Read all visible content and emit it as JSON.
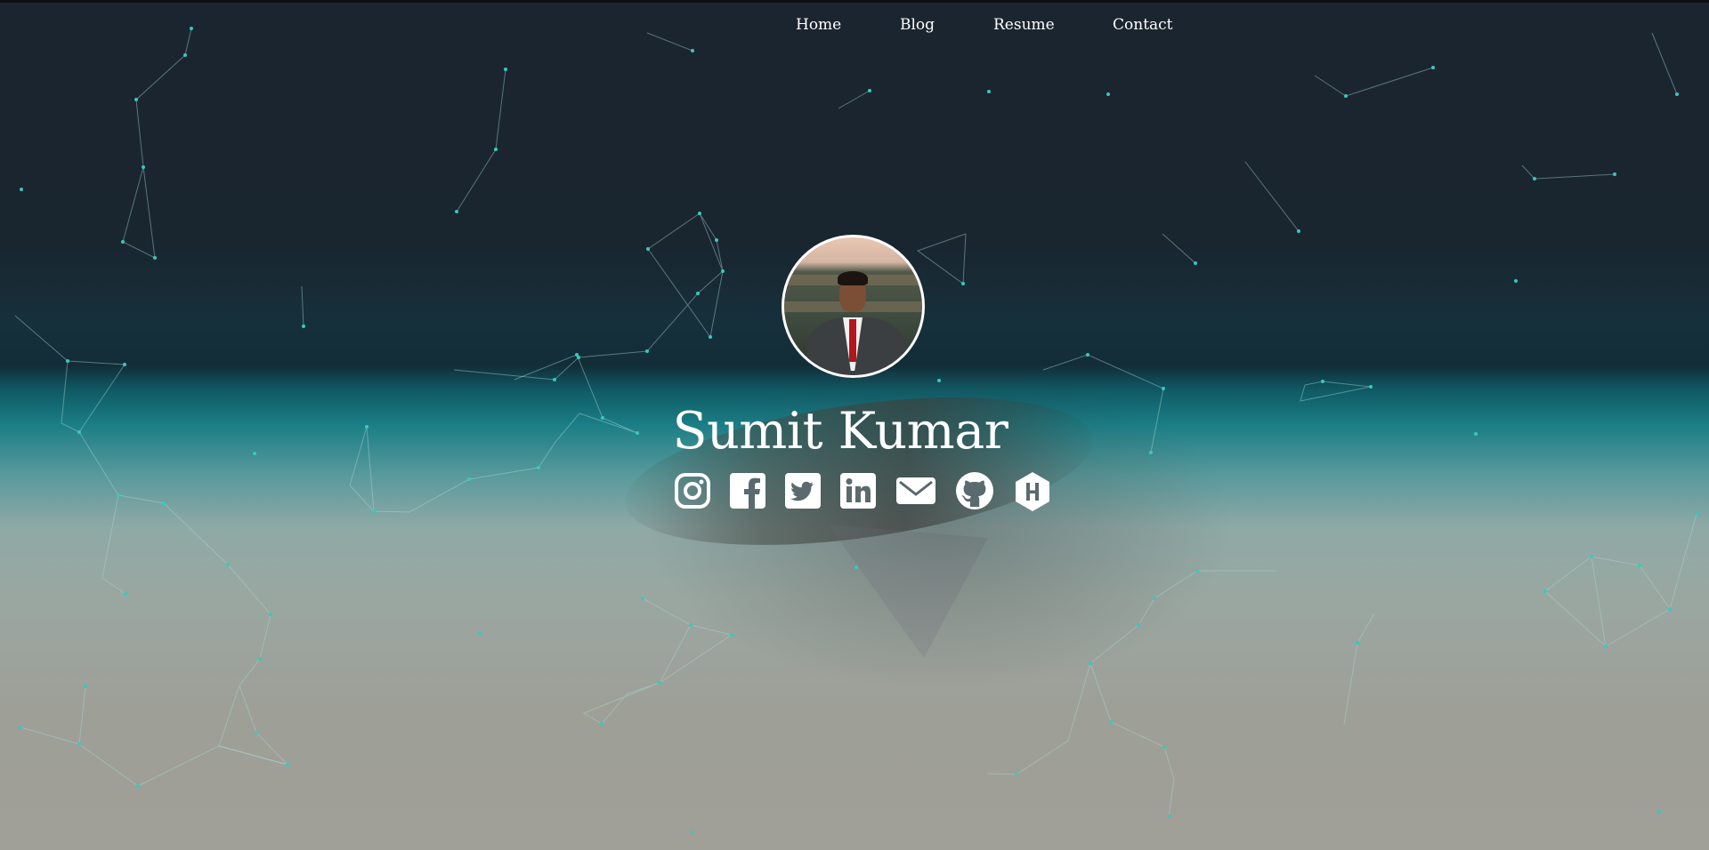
{
  "nav": {
    "items": [
      {
        "label": "Home"
      },
      {
        "label": "Blog"
      },
      {
        "label": "Resume"
      },
      {
        "label": "Contact"
      }
    ]
  },
  "profile": {
    "name": "Sumit Kumar",
    "avatar_alt": "profile-photo"
  },
  "socials": [
    {
      "icon": "instagram-icon"
    },
    {
      "icon": "facebook-icon"
    },
    {
      "icon": "twitter-icon"
    },
    {
      "icon": "linkedin-icon"
    },
    {
      "icon": "email-icon"
    },
    {
      "icon": "github-icon"
    },
    {
      "icon": "hashnode-icon"
    }
  ],
  "colors": {
    "text": "#ffffff",
    "particle": "#38c8c0",
    "bg_dark": "#1b2530",
    "bg_teal": "#1b7e86",
    "bg_sand": "#9e9f97"
  }
}
